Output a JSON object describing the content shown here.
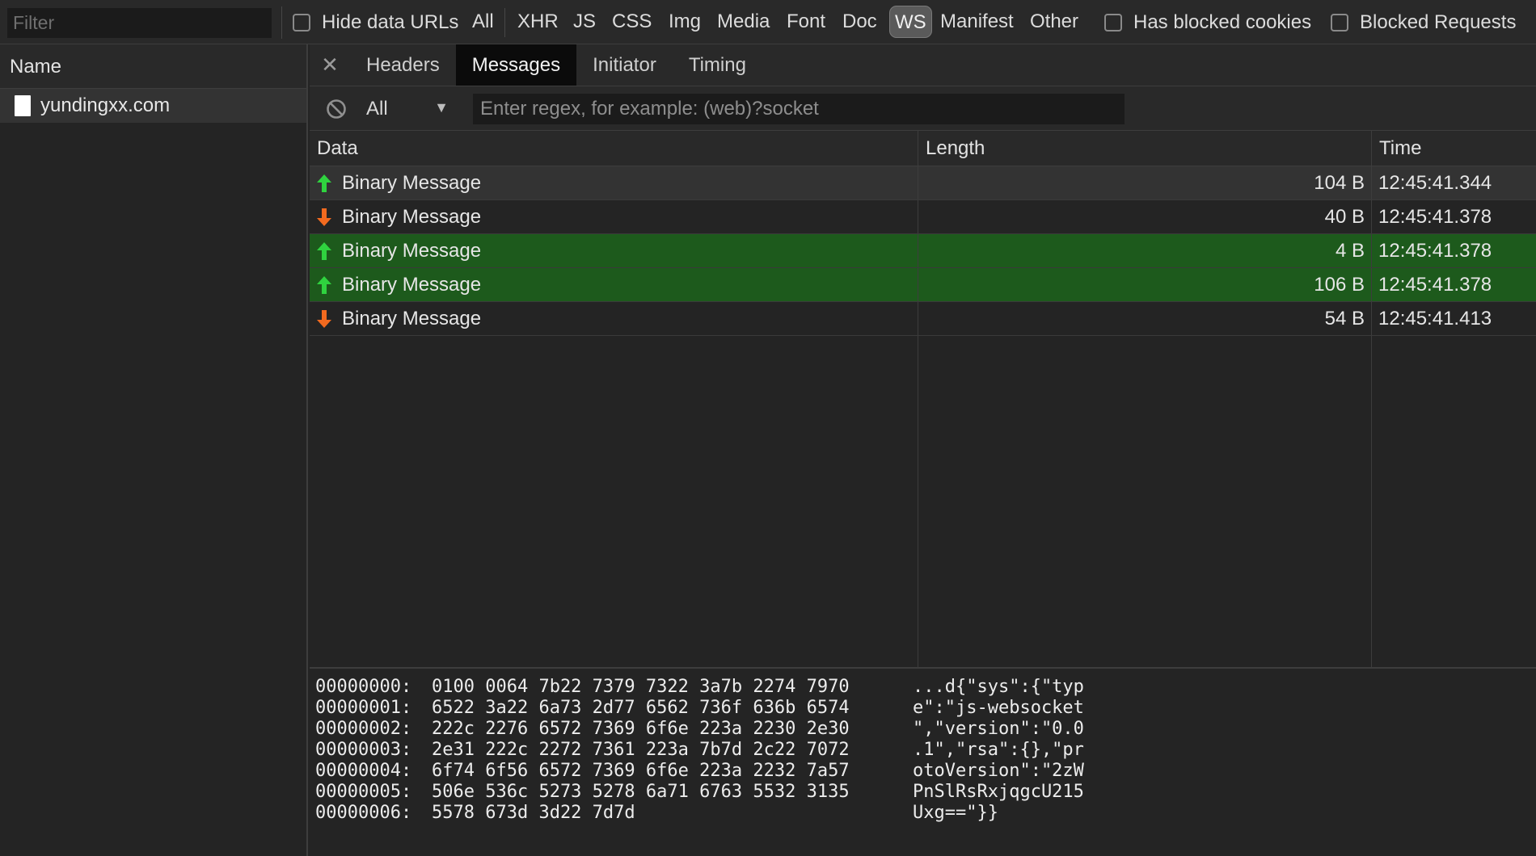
{
  "toolbar": {
    "filter_placeholder": "Filter",
    "hide_data_urls": "Hide data URLs",
    "types": [
      "All",
      "XHR",
      "JS",
      "CSS",
      "Img",
      "Media",
      "Font",
      "Doc",
      "WS",
      "Manifest",
      "Other"
    ],
    "active_type": "WS",
    "has_blocked_cookies": "Has blocked cookies",
    "blocked_requests": "Blocked Requests"
  },
  "sidebar": {
    "header": "Name",
    "items": [
      {
        "label": "yundingxx.com"
      }
    ]
  },
  "detail": {
    "close_icon": "close-icon",
    "tabs": [
      "Headers",
      "Messages",
      "Initiator",
      "Timing"
    ],
    "active_tab": "Messages",
    "direction_filter": "All",
    "regex_placeholder": "Enter regex, for example: (web)?socket",
    "columns": {
      "data": "Data",
      "length": "Length",
      "time": "Time"
    },
    "messages": [
      {
        "direction": "sent",
        "data": "Binary Message",
        "length": "104 B",
        "time": "12:45:41.344",
        "state": "grey"
      },
      {
        "direction": "received",
        "data": "Binary Message",
        "length": "40 B",
        "time": "12:45:41.378",
        "state": "none"
      },
      {
        "direction": "sent",
        "data": "Binary Message",
        "length": "4 B",
        "time": "12:45:41.378",
        "state": "green"
      },
      {
        "direction": "sent",
        "data": "Binary Message",
        "length": "106 B",
        "time": "12:45:41.378",
        "state": "green"
      },
      {
        "direction": "received",
        "data": "Binary Message",
        "length": "54 B",
        "time": "12:45:41.413",
        "state": "none"
      }
    ],
    "hex_dump": [
      {
        "offset": "00000000:",
        "bytes": "0100 0064 7b22 7379 7322 3a7b 2274 7970",
        "ascii": "...d{\"sys\":{\"typ"
      },
      {
        "offset": "00000001:",
        "bytes": "6522 3a22 6a73 2d77 6562 736f 636b 6574",
        "ascii": "e\":\"js-websocket"
      },
      {
        "offset": "00000002:",
        "bytes": "222c 2276 6572 7369 6f6e 223a 2230 2e30",
        "ascii": "\",\"version\":\"0.0"
      },
      {
        "offset": "00000003:",
        "bytes": "2e31 222c 2272 7361 223a 7b7d 2c22 7072",
        "ascii": ".1\",\"rsa\":{},\"pr"
      },
      {
        "offset": "00000004:",
        "bytes": "6f74 6f56 6572 7369 6f6e 223a 2232 7a57",
        "ascii": "otoVersion\":\"2zW"
      },
      {
        "offset": "00000005:",
        "bytes": "506e 536c 5273 5278 6a71 6763 5532 3135",
        "ascii": "PnSlRsRxjqgcU215"
      },
      {
        "offset": "00000006:",
        "bytes": "5578 673d 3d22 7d7d",
        "ascii": "Uxg==\"}}"
      }
    ]
  },
  "colors": {
    "sent_arrow": "#2fd33f",
    "received_arrow": "#f26a1f",
    "selected_green": "#1d5a1c"
  }
}
